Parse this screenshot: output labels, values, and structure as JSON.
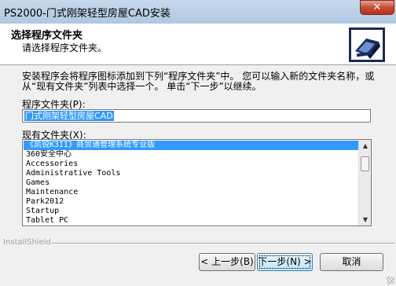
{
  "window": {
    "title": "PS2000-门式刚架轻型房屋CAD安装",
    "close_glyph": "✕"
  },
  "header": {
    "title": "选择程序文件夹",
    "subtitle": "请选择程序文件夹。",
    "logo_icon": "computer-install-icon"
  },
  "description": "安装程序会将程序图标添加到下列“程序文件夹”中。 您可以输入新的文件夹名称，或从“现有文件夹”列表中选择一个。 单击“下一步”以继续。",
  "program_folder": {
    "label": "程序文件夹(P):",
    "value": "门式刚架轻型房屋CAD"
  },
  "existing_folders": {
    "label": "现有文件夹(X):",
    "items": [
      "《凯锐K3II》商贸通管理系统专业版",
      "360安全中心",
      "Accessories",
      "Administrative Tools",
      "Games",
      "Maintenance",
      "Park2012",
      "Startup",
      "Tablet PC"
    ],
    "selected_index": 0,
    "scroll_up_glyph": "▲",
    "scroll_down_glyph": "▼"
  },
  "footer": {
    "brand": "InstallShield"
  },
  "buttons": {
    "back": "< 上一步(B)",
    "next": "下一步(N) >",
    "cancel": "取消"
  }
}
